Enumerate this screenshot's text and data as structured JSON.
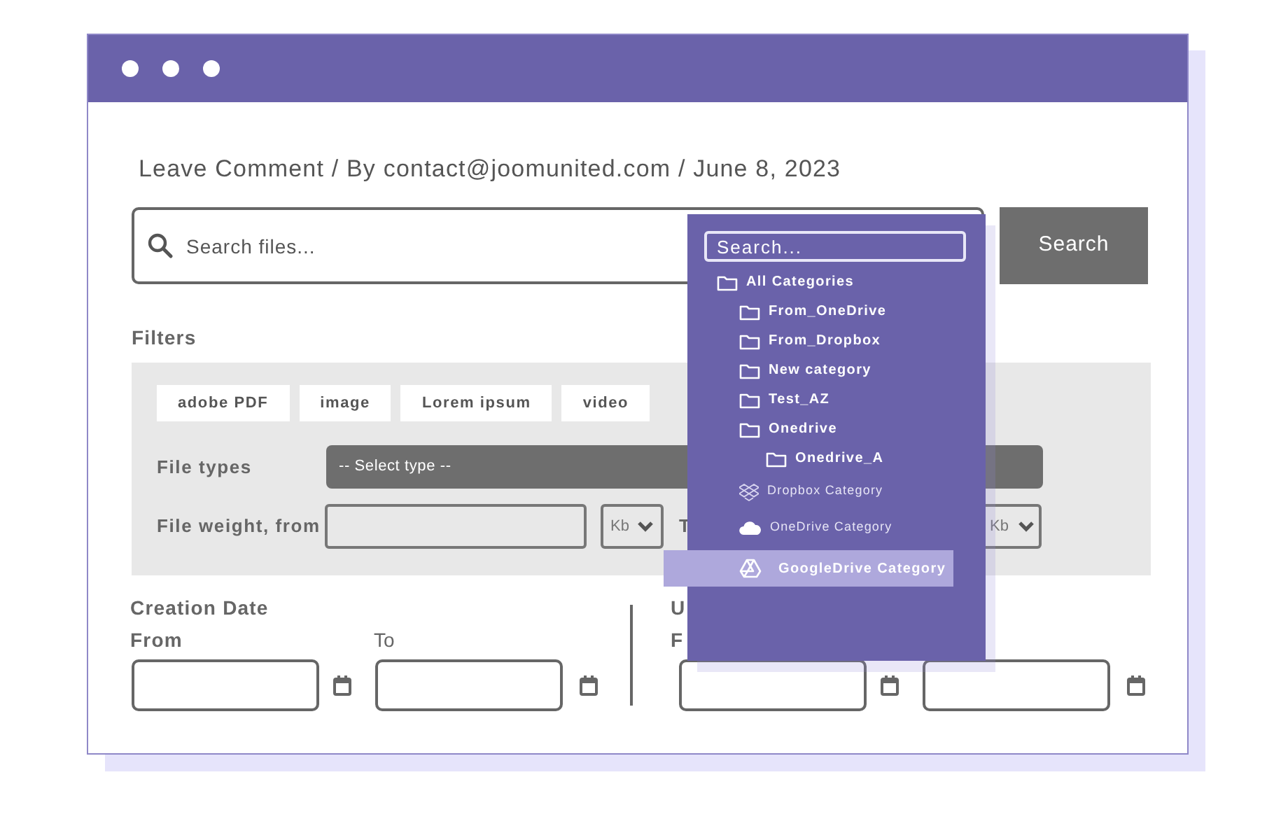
{
  "heading": "Leave Comment / By contact@joomunited.com / June 8, 2023",
  "search": {
    "placeholder": "Search files...",
    "button": "Search"
  },
  "filters": {
    "title": "Filters",
    "tags": [
      "adobe PDF",
      "image",
      "Lorem ipsum",
      "video"
    ],
    "file_types": {
      "label": "File types",
      "value": "-- Select type --"
    },
    "file_weight": {
      "label": "File weight, from",
      "unit": "Kb",
      "to_label": "T",
      "to_unit": "Kb"
    }
  },
  "creation_date": {
    "title": "Creation Date",
    "from_label": "From",
    "to_label": "To"
  },
  "update_date": {
    "title": "U",
    "from_label": "F"
  },
  "category_dropdown": {
    "placeholder": "Search...",
    "items": [
      {
        "label": "All Categories",
        "kind": "folder",
        "selected": false,
        "children": [
          {
            "label": "From_OneDrive",
            "kind": "folder",
            "selected": false
          },
          {
            "label": "From_Dropbox",
            "kind": "folder",
            "selected": false
          },
          {
            "label": "New category",
            "kind": "folder",
            "selected": false
          },
          {
            "label": "Test_AZ",
            "kind": "folder",
            "selected": false
          },
          {
            "label": "Onedrive",
            "kind": "folder",
            "selected": false,
            "children": [
              {
                "label": "Onedrive_A",
                "kind": "folder",
                "selected": false
              }
            ]
          },
          {
            "label": "Dropbox Category",
            "kind": "dropbox",
            "selected": false
          },
          {
            "label": "OneDrive Category",
            "kind": "onedrive",
            "selected": false
          },
          {
            "label": "GoogleDrive Category",
            "kind": "googledrive",
            "selected": true
          }
        ]
      }
    ]
  }
}
